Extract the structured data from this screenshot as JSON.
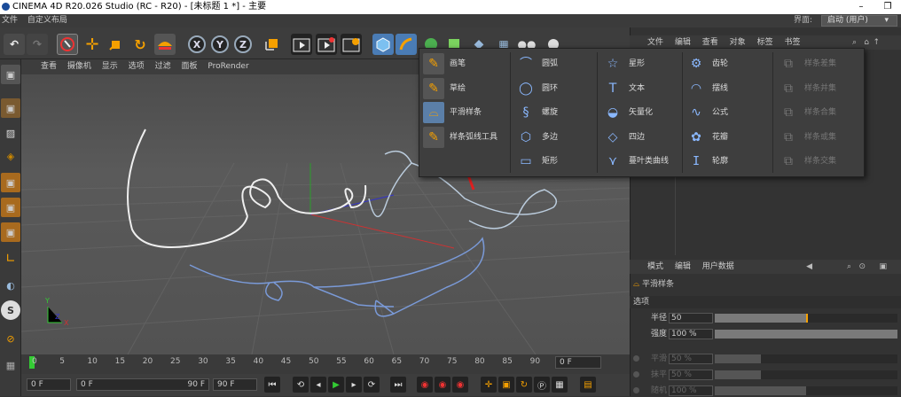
{
  "window": {
    "title": "CINEMA 4D R20.026 Studio (RC - R20) - [未标题 1 *] - 主要",
    "minimize": "–",
    "restore": "❐"
  },
  "menubar": {
    "items": [
      "文件",
      "自定义布局"
    ],
    "layout_label": "界面:",
    "layout_value": "启动 (用户)"
  },
  "viewport_menu": [
    "查看",
    "摄像机",
    "显示",
    "选项",
    "过滤",
    "面板",
    "ProRender"
  ],
  "toolbar": {
    "x": "X",
    "y": "Y",
    "z": "Z"
  },
  "dropdown": {
    "col1": [
      "画笔",
      "草绘",
      "平滑样条",
      "样条弧线工具"
    ],
    "col2": [
      "圆弧",
      "圆环",
      "螺旋",
      "多边",
      "矩形"
    ],
    "col3": [
      "星形",
      "文本",
      "矢量化",
      "四边",
      "蔓叶类曲线"
    ],
    "col4": [
      "齿轮",
      "摆线",
      "公式",
      "花瓣",
      "轮廓"
    ],
    "col5": [
      "样条差集",
      "样条并集",
      "样条合集",
      "样条或集",
      "样条交集"
    ]
  },
  "right_panel": {
    "menu": [
      "文件",
      "编辑",
      "查看",
      "对象",
      "标签",
      "书签"
    ]
  },
  "attributes": {
    "menu": [
      "模式",
      "编辑",
      "用户数据"
    ],
    "object_name": "平滑样条",
    "section": "选项",
    "rows": [
      {
        "label": "半径",
        "value": "50",
        "fill": 0.5,
        "active": true
      },
      {
        "label": "强度",
        "value": "100 %",
        "fill": 1.0,
        "active": true
      },
      {
        "label": "平滑",
        "value": "50 %",
        "fill": 0.5,
        "active": false
      },
      {
        "label": "抹平",
        "value": "50 %",
        "fill": 0.5,
        "active": false
      },
      {
        "label": "随机",
        "value": "100 %",
        "fill": 1.0,
        "active": false
      }
    ]
  },
  "timeline": {
    "ticks": [
      "0",
      "5",
      "10",
      "15",
      "20",
      "25",
      "30",
      "35",
      "40",
      "45",
      "50",
      "55",
      "60",
      "65",
      "70",
      "75",
      "80",
      "85",
      "90"
    ],
    "end_field": "0 F"
  },
  "playbar": {
    "start": "0 F",
    "min": "0 F",
    "max": "90 F",
    "end": "90 F"
  },
  "axis_labels": {
    "y": "Y",
    "z": "Z",
    "x": "X"
  }
}
